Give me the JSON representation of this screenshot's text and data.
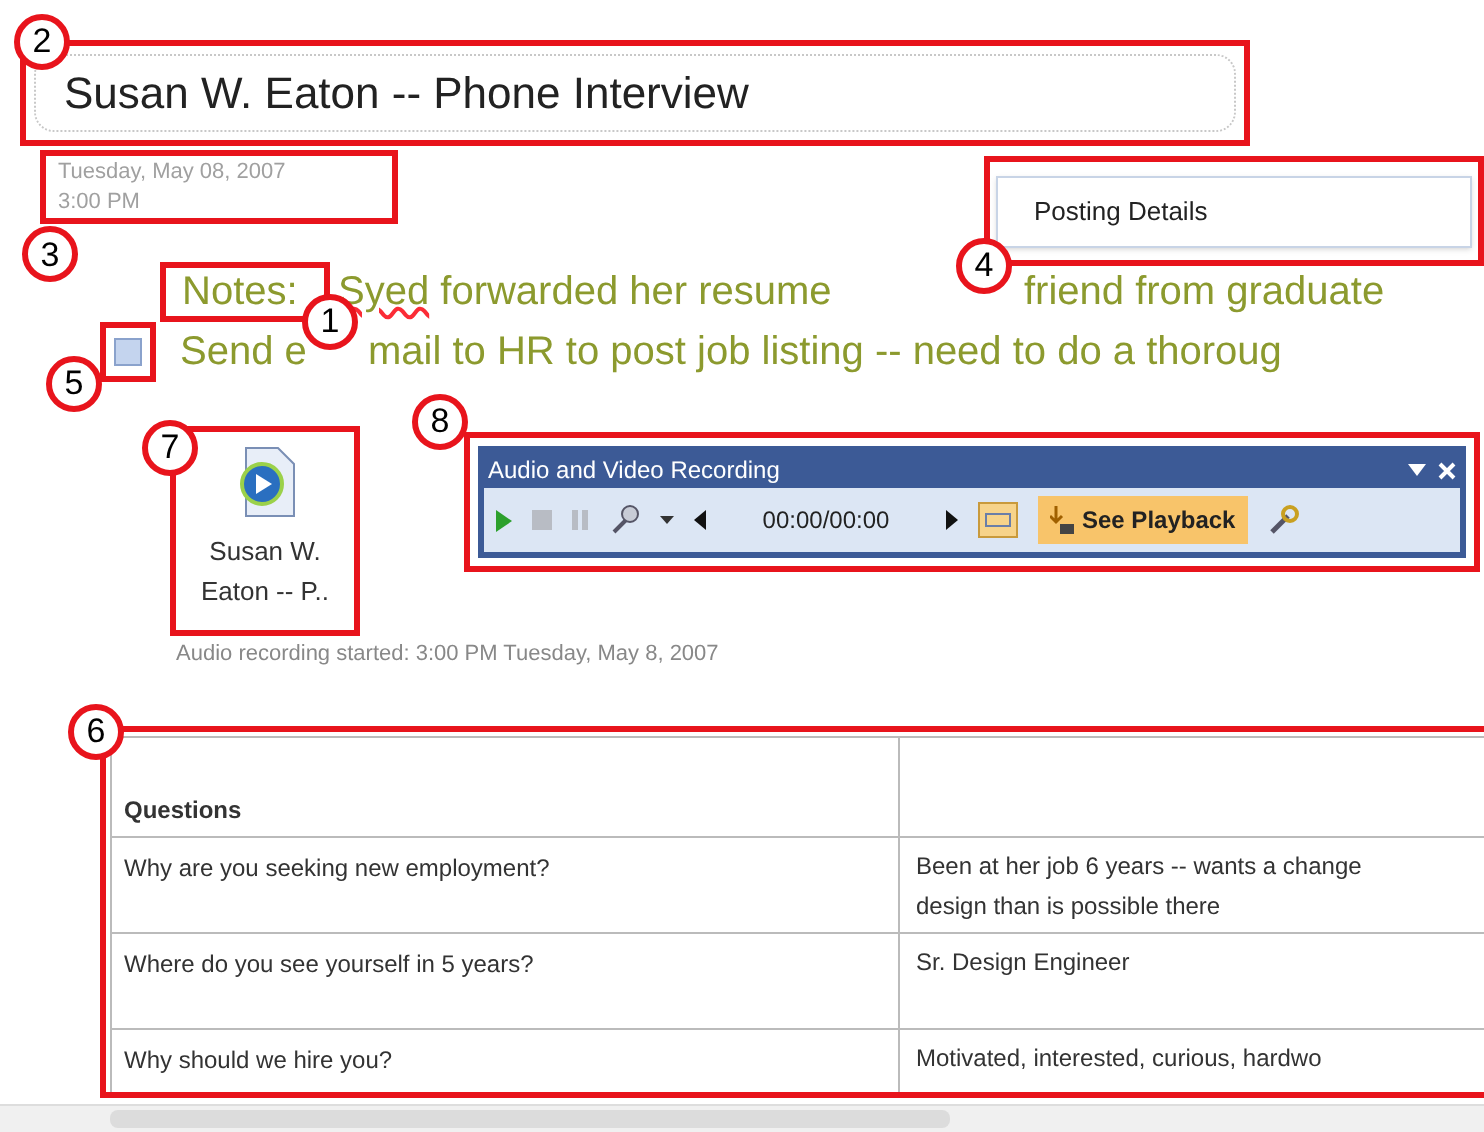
{
  "page": {
    "title": "Susan W. Eaton -- Phone Interview",
    "date": "Tuesday, May 08, 2007",
    "time": "3:00 PM",
    "tag_menu": {
      "label": "Posting Details"
    },
    "notes": [
      {
        "kind": "text",
        "parts": [
          "Notes:",
          "Syed",
          " forwarded  her resume",
          "friend from graduate"
        ]
      },
      {
        "kind": "todo",
        "checked": false,
        "parts": [
          "Send e",
          "mail to HR to post job listing -- need to do a thoroug"
        ]
      }
    ],
    "attachment": {
      "label": "Susan W. Eaton -- P..",
      "caption": "Audio recording started: 3:00 PM Tuesday, May 8, 2007"
    },
    "recorder": {
      "title": "Audio and Video Recording",
      "time": "00:00/00:00",
      "playback_button": "See Playback"
    },
    "table": {
      "columns": [
        "Questions"
      ],
      "rows": [
        [
          "Why are you seeking new  employment?",
          "Been  at her  job 6 years -- wants a change",
          "design than is possible there"
        ],
        [
          "Where do you see yourself in 5 years?",
          "Sr. Design Engineer"
        ],
        [
          "Why should we hire you?",
          "Motivated,  interested,  curious, hardwo"
        ]
      ]
    }
  },
  "callouts": [
    {
      "number": "1"
    },
    {
      "number": "2"
    },
    {
      "number": "3"
    },
    {
      "number": "4"
    },
    {
      "number": "5"
    },
    {
      "number": "6"
    },
    {
      "number": "7"
    },
    {
      "number": "8"
    }
  ]
}
